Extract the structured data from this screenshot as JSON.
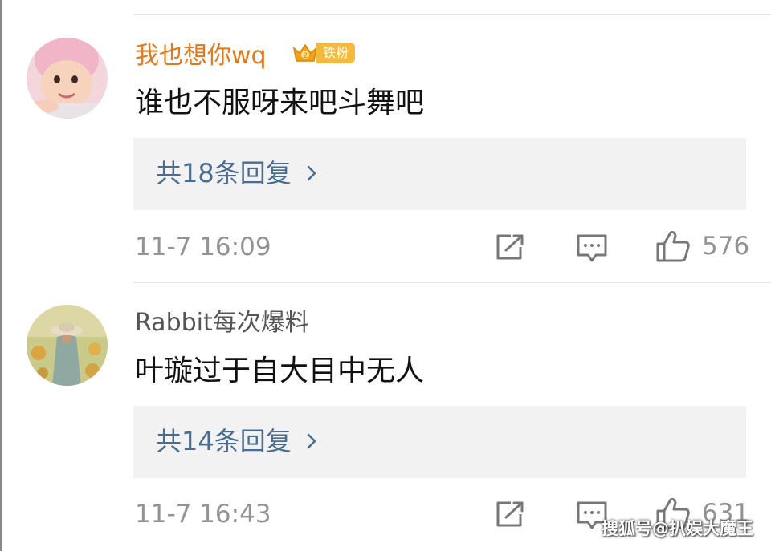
{
  "comments": [
    {
      "username": "我也想你wq",
      "badge_label": "铁粉",
      "text": "谁也不服呀来吧斗舞吧",
      "replies_label": "共18条回复",
      "time": "11-7 16:09",
      "like_count": "576",
      "username_color": "#e07a1f"
    },
    {
      "username": "Rabbit每次爆料",
      "text": "叶璇过于自大目中无人",
      "replies_label": "共14条回复",
      "time": "11-7 16:43",
      "like_count": "631",
      "username_color": "#555555"
    }
  ],
  "icons": {
    "share": "share-icon",
    "comment": "comment-icon",
    "like": "thumbs-up-icon",
    "chevron": "chevron-right-icon",
    "badge": "crown-badge-icon"
  },
  "watermark": "搜狐号@扒娱大魔王"
}
